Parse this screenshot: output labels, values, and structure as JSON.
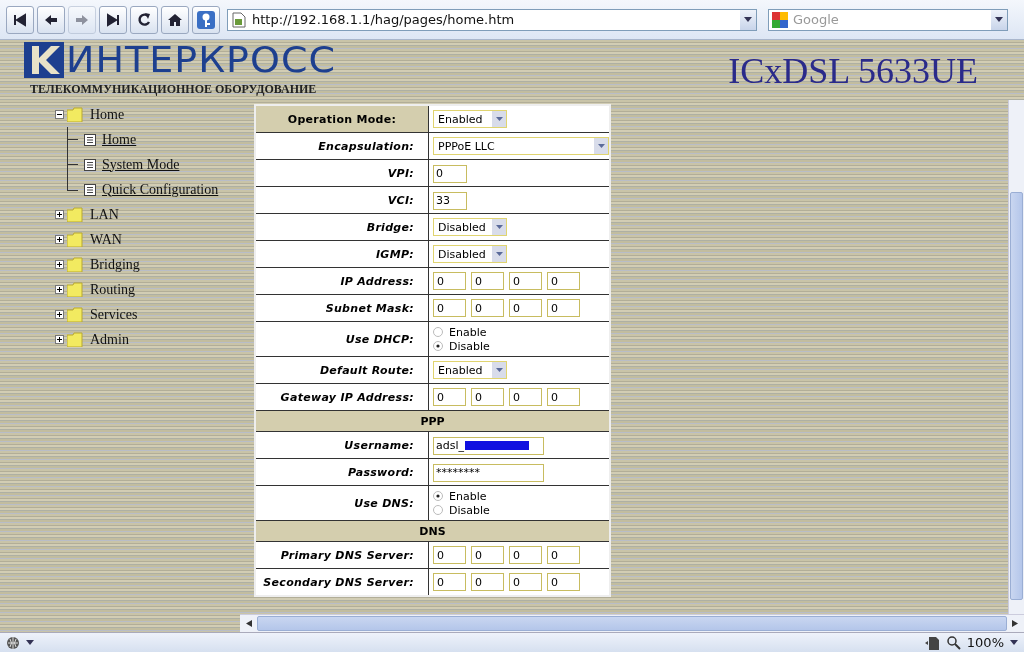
{
  "browser": {
    "url": "http://192.168.1.1/hag/pages/home.htm",
    "search_placeholder": "Google",
    "zoom": "100%",
    "forward_disabled": true
  },
  "header": {
    "logo": "ИНТЕРКРОСС",
    "tagline": "ТЕЛЕКОММУНИКАЦИОННОЕ ОБОРУДОВАНИЕ",
    "model": "ICxDSL 5633UE"
  },
  "tree": [
    {
      "label": "Home",
      "expanded": true,
      "children": [
        {
          "label": "Home"
        },
        {
          "label": "System Mode"
        },
        {
          "label": "Quick Configuration"
        }
      ]
    },
    {
      "label": "LAN",
      "expanded": false
    },
    {
      "label": "WAN",
      "expanded": false
    },
    {
      "label": "Bridging",
      "expanded": false
    },
    {
      "label": "Routing",
      "expanded": false
    },
    {
      "label": "Services",
      "expanded": false
    },
    {
      "label": "Admin",
      "expanded": false
    }
  ],
  "form": [
    {
      "kind": "select",
      "label": "Operation Mode:",
      "value": "Enabled",
      "highlight": true
    },
    {
      "kind": "select",
      "label": "Encapsulation:",
      "value": "PPPoE LLC",
      "wide": true
    },
    {
      "kind": "text",
      "label": "VPI:",
      "value": "0"
    },
    {
      "kind": "text",
      "label": "VCI:",
      "value": "33"
    },
    {
      "kind": "select",
      "label": "Bridge:",
      "value": "Disabled"
    },
    {
      "kind": "select",
      "label": "IGMP:",
      "value": "Disabled"
    },
    {
      "kind": "ip",
      "label": "IP Address:",
      "octets": [
        "0",
        "0",
        "0",
        "0"
      ]
    },
    {
      "kind": "ip",
      "label": "Subnet Mask:",
      "octets": [
        "0",
        "0",
        "0",
        "0"
      ]
    },
    {
      "kind": "radio",
      "label": "Use DHCP:",
      "options": [
        {
          "label": "Enable",
          "selected": false
        },
        {
          "label": "Disable",
          "selected": true
        }
      ]
    },
    {
      "kind": "select",
      "label": "Default Route:",
      "value": "Enabled"
    },
    {
      "kind": "ip",
      "label": "Gateway IP Address:",
      "octets": [
        "0",
        "0",
        "0",
        "0"
      ]
    },
    {
      "kind": "section",
      "label": "PPP"
    },
    {
      "kind": "text",
      "label": "Username:",
      "value": "adsl_",
      "redacted": true
    },
    {
      "kind": "text",
      "label": "Password:",
      "value": "********"
    },
    {
      "kind": "radio",
      "label": "Use DNS:",
      "options": [
        {
          "label": "Enable",
          "selected": true
        },
        {
          "label": "Disable",
          "selected": false
        }
      ]
    },
    {
      "kind": "section",
      "label": "DNS"
    },
    {
      "kind": "ip",
      "label": "Primary DNS Server:",
      "octets": [
        "0",
        "0",
        "0",
        "0"
      ]
    },
    {
      "kind": "ip",
      "label": "Secondary DNS Server:",
      "octets": [
        "0",
        "0",
        "0",
        "0"
      ]
    }
  ]
}
